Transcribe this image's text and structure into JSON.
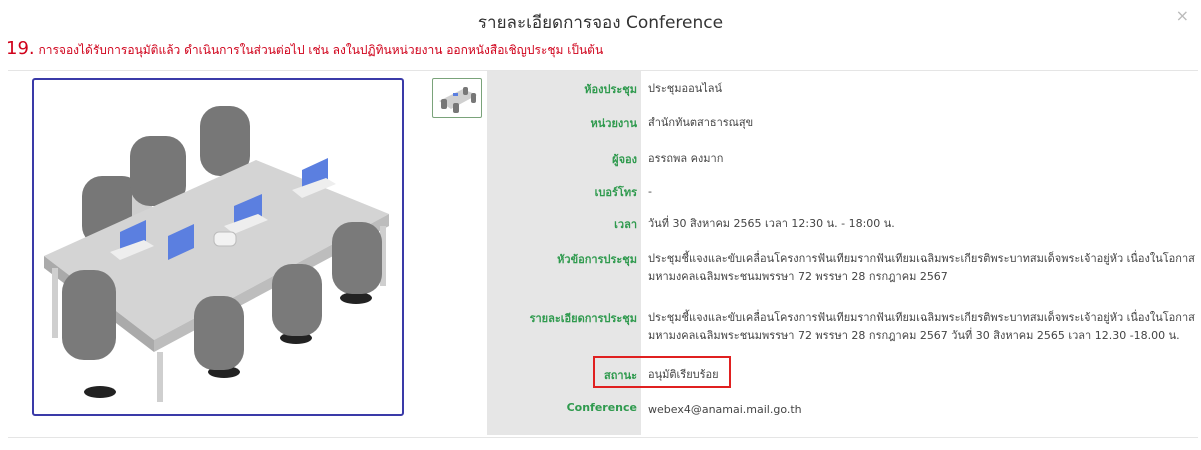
{
  "dialog": {
    "title": "รายละเอียดการจอง Conference",
    "close_label": "×"
  },
  "note": {
    "number": "19.",
    "text": "การจองได้รับการอนุมัติแล้ว ดำเนินการในส่วนต่อไป เช่น ลงในปฏิทินหน่วยงาน ออกหนังสือเชิญประชุม เป็นต้น"
  },
  "details": {
    "room": {
      "label": "ห้องประชุม",
      "value": "ประชุมออนไลน์"
    },
    "department": {
      "label": "หน่วยงาน",
      "value": "สำนักทันตสาธารณสุข"
    },
    "booker": {
      "label": "ผู้จอง",
      "value": "อรรถพล คงมาก"
    },
    "phone": {
      "label": "เบอร์โทร",
      "value": "-"
    },
    "time": {
      "label": "เวลา",
      "value": "วันที่ 30 สิงหาคม 2565 เวลา 12:30 น. - 18:00 น."
    },
    "topic": {
      "label": "หัวข้อการประชุม",
      "value": "ประชุมชี้แจงและขับเคลื่อนโครงการฟันเทียมรากฟันเทียมเฉลิมพระเกียรติพระบาทสมเด็จพระเจ้าอยู่หัว เนื่องในโอกาสมหามงคลเฉลิมพระชนมพรรษา 72 พรรษา 28 กรกฎาคม 2567"
    },
    "description": {
      "label": "รายละเอียดการประชุม",
      "value": "ประชุมชี้แจงและขับเคลื่อนโครงการฟันเทียมรากฟันเทียมเฉลิมพระเกียรติพระบาทสมเด็จพระเจ้าอยู่หัว เนื่องในโอกาสมหามงคลเฉลิมพระชนมพรรษา 72 พรรษา 28 กรกฎาคม 2567 วันที่ 30 สิงหาคม 2565 เวลา 12.30 -18.00 น."
    },
    "status": {
      "label": "สถานะ",
      "value": "อนุมัติเรียบร้อย"
    },
    "conference": {
      "label": "Conference",
      "value": "webex4@anamai.mail.go.th"
    }
  },
  "colors": {
    "label_green": "#2f9a4e",
    "note_red": "#d0021b",
    "image_border": "#3a3aa8",
    "status_highlight": "#e02020"
  }
}
